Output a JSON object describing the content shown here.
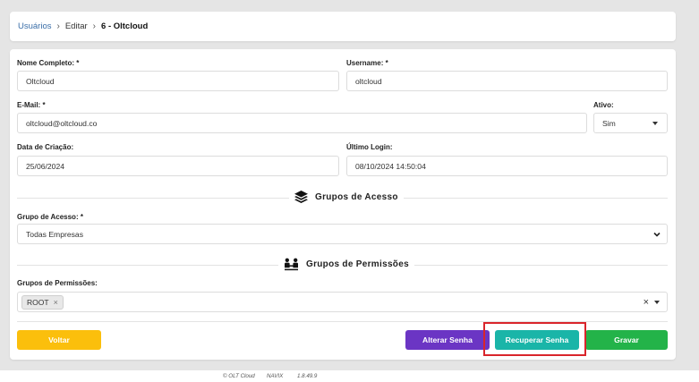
{
  "breadcrumb": {
    "root": "Usuários",
    "edit": "Editar",
    "current": "6 - Oltcloud"
  },
  "form": {
    "nome_label": "Nome Completo: *",
    "nome_value": "Oltcloud",
    "username_label": "Username: *",
    "username_value": "oltcloud",
    "email_label": "E-Mail: *",
    "email_value": "oltcloud@oltcloud.co",
    "ativo_label": "Ativo:",
    "ativo_value": "Sim",
    "data_criacao_label": "Data de Criação:",
    "data_criacao_value": "25/06/2024",
    "ultimo_login_label": "Último Login:",
    "ultimo_login_value": "08/10/2024 14:50:04",
    "grupo_acesso_label": "Grupo de Acesso: *",
    "grupo_acesso_value": "Todas Empresas",
    "grupos_permissoes_label": "Grupos de Permissões:",
    "grupos_permissoes_tags": [
      "ROOT"
    ]
  },
  "sections": {
    "acesso_title": "Grupos de Acesso",
    "permissoes_title": "Grupos de Permissões"
  },
  "buttons": {
    "voltar": "Voltar",
    "alterar_senha": "Alterar Senha",
    "recuperar_senha": "Recuperar Senha",
    "gravar": "Gravar"
  },
  "footer": {
    "copyright": "© OLT Cloud",
    "brand": "NAVIX",
    "version": "1.8.49.9"
  },
  "colors": {
    "voltar": "#fbbf0c",
    "alterar_senha": "#6b35c4",
    "recuperar_senha": "#1ab5a8",
    "gravar": "#23b349",
    "highlight": "#d9252b",
    "link": "#3a6ea8"
  },
  "icons": {
    "acesso": "layers-icon",
    "permissoes": "users-group-icon"
  }
}
